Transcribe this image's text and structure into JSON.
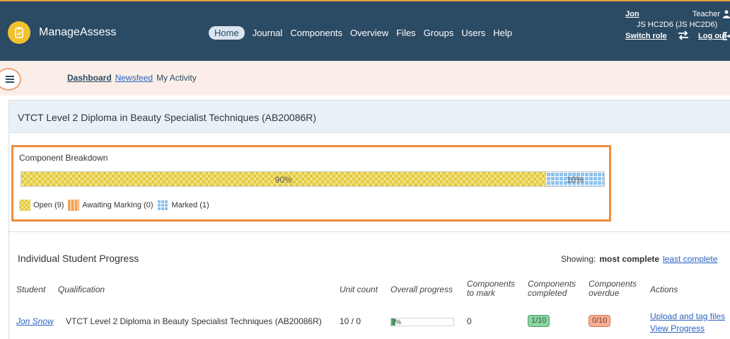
{
  "app": {
    "name": "ManageAssess",
    "brand_color": "#2b4a63",
    "logo_color": "#f2c12e"
  },
  "nav": {
    "items": [
      "Home",
      "Journal",
      "Components",
      "Overview",
      "Files",
      "Groups",
      "Users",
      "Help"
    ],
    "active": "Home"
  },
  "user": {
    "name": "Jon",
    "role": "Teacher",
    "group": "JS HC2D6 (JS HC2D6)",
    "switch_role": "Switch role",
    "logout": "Log out"
  },
  "subnav": {
    "dashboard": "Dashboard",
    "newsfeed": "Newsfeed",
    "my_activity": "My Activity"
  },
  "course": {
    "title": "VTCT Level 2 Diploma in Beauty Specialist Techniques (AB20086R)"
  },
  "breakdown": {
    "title": "Component Breakdown",
    "open_percent_label": "90%",
    "marked_percent_label": "10%",
    "open_fraction": 0.9,
    "marked_fraction": 0.1,
    "legend": {
      "open": "Open (9)",
      "awaiting": "Awaiting Marking (0)",
      "marked": "Marked (1)"
    }
  },
  "progress": {
    "title": "Individual Student Progress",
    "showing_label": "Showing:",
    "showing_most": "most complete",
    "showing_least": "least complete",
    "headers": {
      "student": "Student",
      "qualification": "Qualification",
      "unit_count": "Unit count",
      "overall_progress": "Overall progress",
      "components_to_mark_1": "Components",
      "components_to_mark_2": "to mark",
      "components_completed_1": "Components",
      "components_completed_2": "completed",
      "components_overdue_1": "Components",
      "components_overdue_2": "overdue",
      "actions": "Actions"
    },
    "rows": [
      {
        "student": "Jon Snow",
        "qualification": "VTCT Level 2 Diploma in Beauty Specialist Techniques (AB20086R)",
        "unit_count": "10 / 0",
        "overall_progress_label": "7%",
        "overall_progress_fraction": 0.07,
        "components_to_mark": "0",
        "components_completed": "1/10",
        "components_overdue": "0/10",
        "action_upload": "Upload and tag files",
        "action_view": "View Progress"
      }
    ]
  }
}
